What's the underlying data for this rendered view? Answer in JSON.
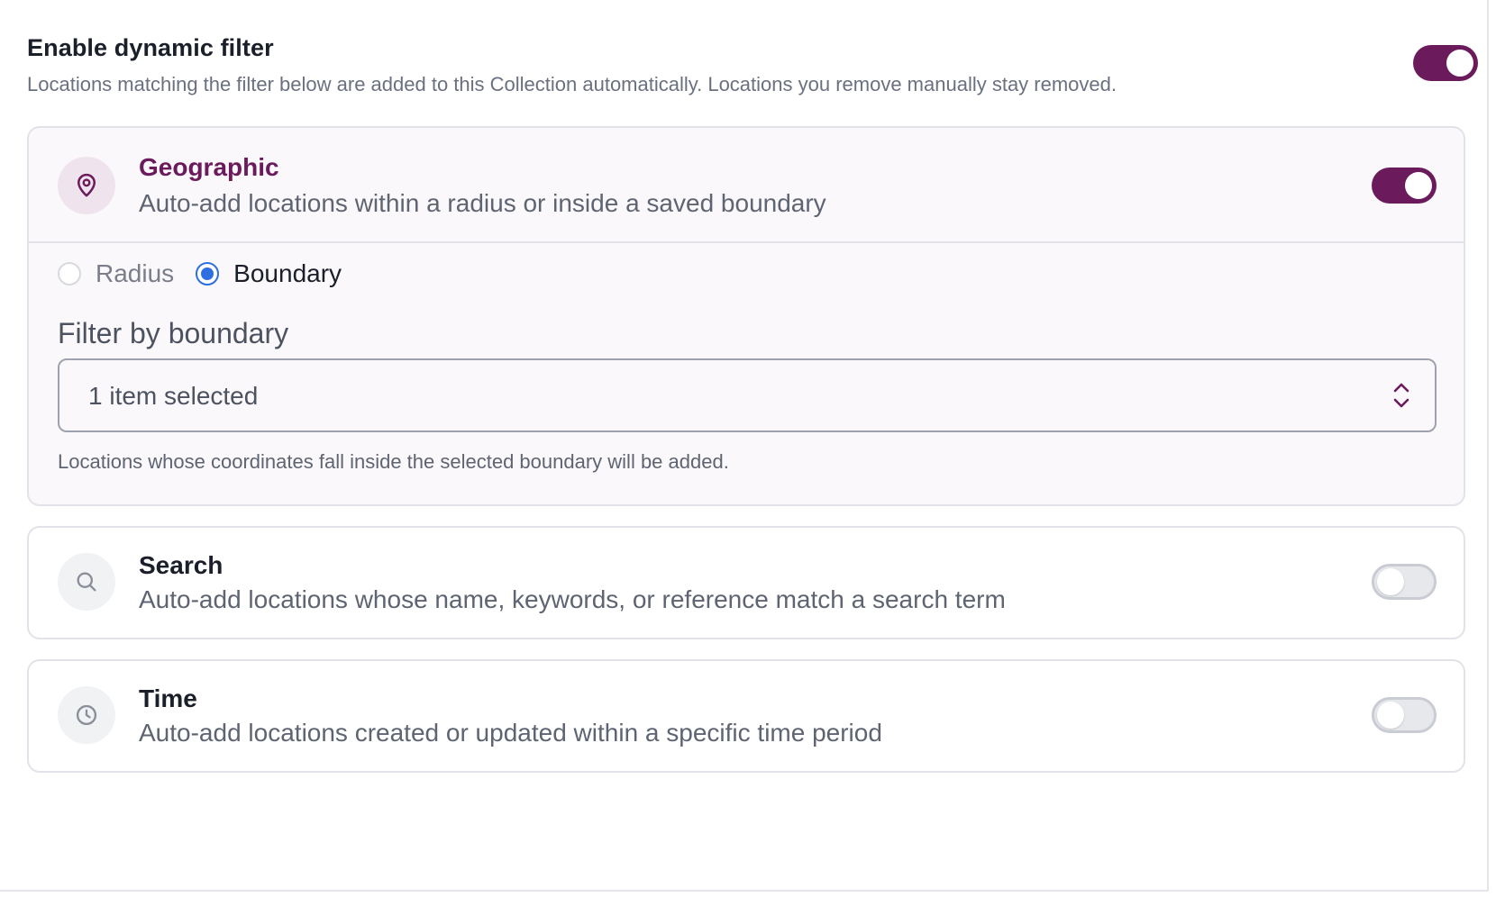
{
  "header": {
    "title": "Enable dynamic filter",
    "description": "Locations matching the filter below are added to this Collection automatically. Locations you remove manually stay removed.",
    "toggle_on": true
  },
  "filters": {
    "geographic": {
      "title": "Geographic",
      "description": "Auto-add locations within a radius or inside a saved boundary",
      "toggle_on": true,
      "icon": "map-pin-icon",
      "mode_options": [
        "Radius",
        "Boundary"
      ],
      "selected_mode": "Boundary",
      "field_label": "Filter by boundary",
      "select_value": "1 item selected",
      "help_text": "Locations whose coordinates fall inside the selected boundary will be added."
    },
    "search": {
      "title": "Search",
      "description": "Auto-add locations whose name, keywords, or reference match a search term",
      "toggle_on": false,
      "icon": "search-icon"
    },
    "time": {
      "title": "Time",
      "description": "Auto-add locations created or updated within a specific time period",
      "toggle_on": false,
      "icon": "clock-icon"
    }
  },
  "colors": {
    "accent": "#6b1a5c",
    "radio_accent": "#2d6fe0",
    "border": "#e2e3e8"
  }
}
